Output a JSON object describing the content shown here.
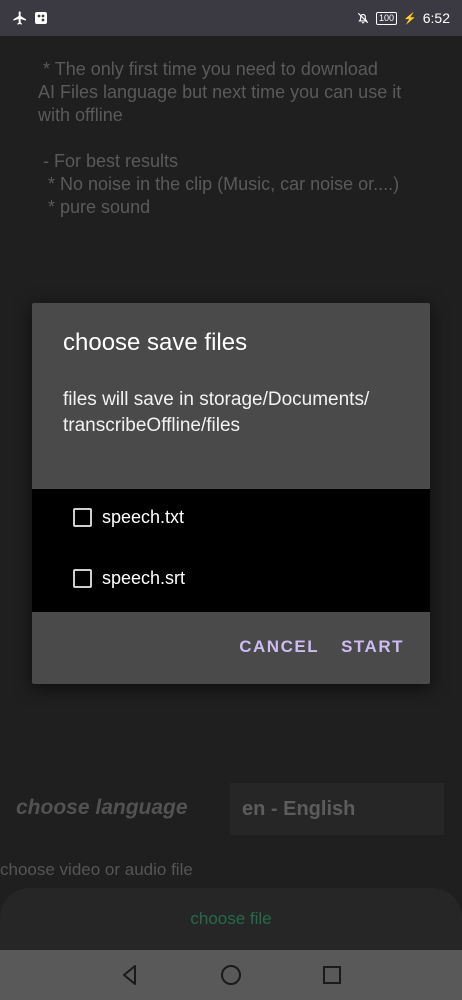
{
  "status": {
    "time": "6:52",
    "battery": "100"
  },
  "info_text": " * The only first time you need to download\nAI Files language but next time you can use it\nwith offline\n\n - For best results\n  * No noise in the clip (Music, car noise or....)\n  * pure sound",
  "dialog": {
    "title": "choose save files",
    "message": "files will save in storage/Documents/ transcribeOffline/files",
    "options": [
      {
        "label": "speech.txt",
        "checked": false
      },
      {
        "label": "speech.srt",
        "checked": false
      }
    ],
    "cancel_label": "CANCEL",
    "start_label": "START"
  },
  "language": {
    "label": "choose language",
    "selected": "en - English"
  },
  "file": {
    "hint": "choose video or audio file",
    "button_label": "choose file"
  },
  "colors": {
    "accent": "#cdbbf2",
    "file_button_text": "#256a4b"
  }
}
